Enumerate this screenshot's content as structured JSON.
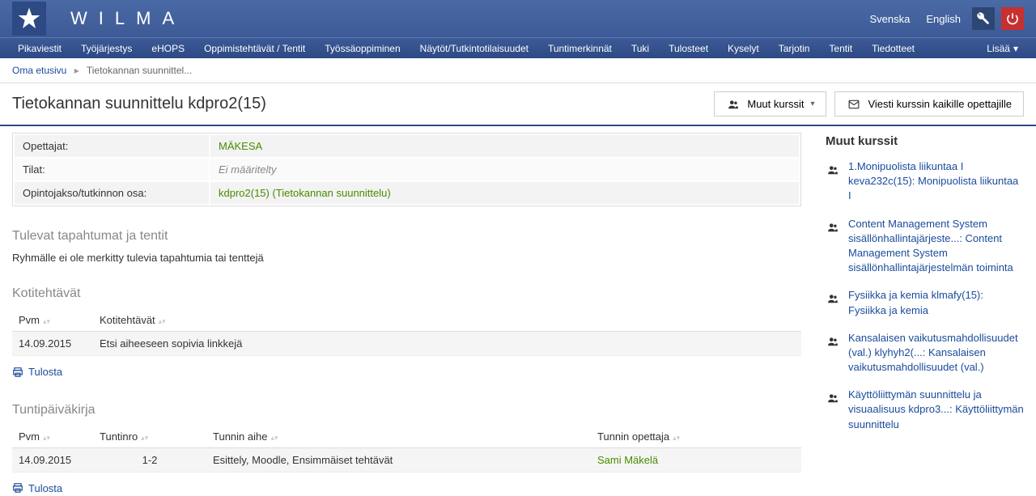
{
  "brand": "WILMA",
  "header": {
    "lang_sv": "Svenska",
    "lang_en": "English"
  },
  "nav": {
    "items": [
      "Pikaviestit",
      "Työjärjestys",
      "eHOPS",
      "Oppimistehtävät / Tentit",
      "Työssäoppiminen",
      "Näytöt/Tutkintotilaisuudet",
      "Tuntimerkinnät",
      "Tuki",
      "Tulosteet",
      "Kyselyt",
      "Tarjotin",
      "Tentit",
      "Tiedotteet"
    ],
    "more": "Lisää"
  },
  "breadcrumb": {
    "home": "Oma etusivu",
    "current": "Tietokannan suunnittel..."
  },
  "title": "Tietokannan suunnittelu kdpro2(15)",
  "actions": {
    "other_courses": "Muut kurssit",
    "message_teachers": "Viesti kurssin kaikille opettajille"
  },
  "info": {
    "teachers_label": "Opettajat:",
    "teachers_value": "MÄKESA",
    "rooms_label": "Tilat:",
    "rooms_value": "Ei määritelty",
    "period_label": "Opintojakso/tutkinnon osa:",
    "period_value": "kdpro2(15) (Tietokannan suunnittelu)"
  },
  "upcoming": {
    "heading": "Tulevat tapahtumat ja tentit",
    "empty": "Ryhmälle ei ole merkitty tulevia tapahtumia tai tenttejä"
  },
  "homework": {
    "heading": "Kotitehtävät",
    "cols": {
      "date": "Pvm",
      "task": "Kotitehtävät"
    },
    "rows": [
      {
        "date": "14.09.2015",
        "task": "Etsi aiheeseen sopivia linkkejä"
      }
    ]
  },
  "diary": {
    "heading": "Tuntipäiväkirja",
    "cols": {
      "date": "Pvm",
      "num": "Tuntinro",
      "topic": "Tunnin aihe",
      "teacher": "Tunnin opettaja"
    },
    "rows": [
      {
        "date": "14.09.2015",
        "num": "1-2",
        "topic": "Esittely, Moodle, Ensimmäiset tehtävät",
        "teacher": "Sami Mäkelä"
      }
    ]
  },
  "print_label": "Tulosta",
  "sidebar": {
    "heading": "Muut kurssit",
    "items": [
      "1.Monipuolista liikuntaa I keva232c(15): Monipuolista liikuntaa I",
      "Content Management System sisällönhallintajärjeste...: Content Management System sisällönhallintajärjestelmän toiminta",
      "Fysiikka ja kemia klmafy(15): Fysiikka ja kemia",
      "Kansalaisen vaikutusmahdollisuudet (val.) klyhyh2(...: Kansalaisen vaikutusmahdollisuudet (val.)",
      "Käyttöliittymän suunnittelu ja visuaalisuus kdpro3...: Käyttöliittymän suunnittelu"
    ]
  }
}
